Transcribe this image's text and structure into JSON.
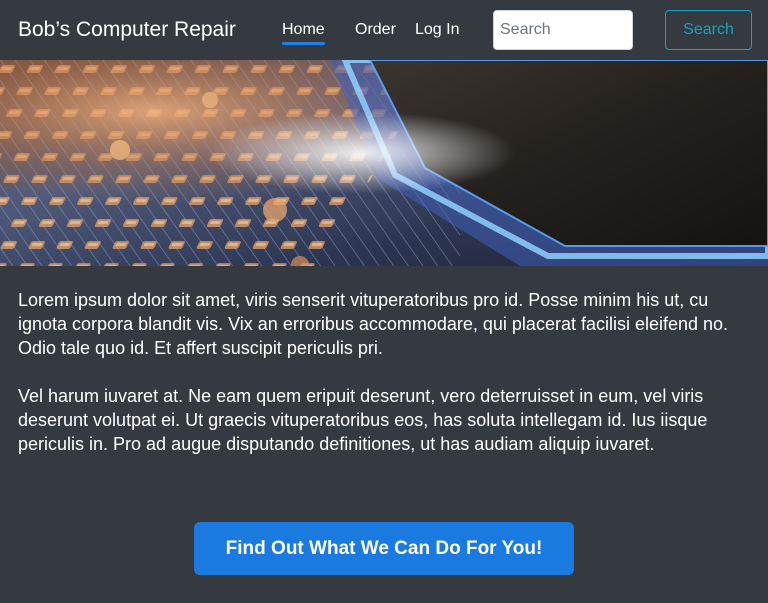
{
  "navbar": {
    "brand": "Bob’s Computer Repair",
    "links": [
      {
        "label": "Home",
        "active": true
      },
      {
        "label": "Order",
        "active": false
      },
      {
        "label": "Log In",
        "active": false
      }
    ],
    "search": {
      "placeholder": "Search",
      "value": "",
      "button_label": "Search"
    }
  },
  "hero": {
    "image": "circuit-board-chip-image"
  },
  "main": {
    "paragraphs": [
      "Lorem ipsum dolor sit amet, viris senserit vituperatoribus pro id. Posse minim his ut, cu ignota corpora blandit vis. Vix an erroribus accommodare, qui placerat facilisi eleifend no. Odio tale quo id. Et affert suscipit periculis pri.",
      "Vel harum iuvaret at. Ne eam quem eripuit deserunt, vero deterruisset in eum, vel viris deserunt volutpat ei. Ut graecis vituperatoribus eos, has soluta intellegam id. Ius iisque periculis in. Pro ad augue disputando definitiones, ut has audiam aliquip iuvaret."
    ],
    "cta_label": "Find Out What We Can Do For You!"
  },
  "colors": {
    "background": "#343a40",
    "active_underline": "#1f7fe5",
    "search_button": "#17a2b8",
    "cta_button": "#1a7ae0"
  }
}
